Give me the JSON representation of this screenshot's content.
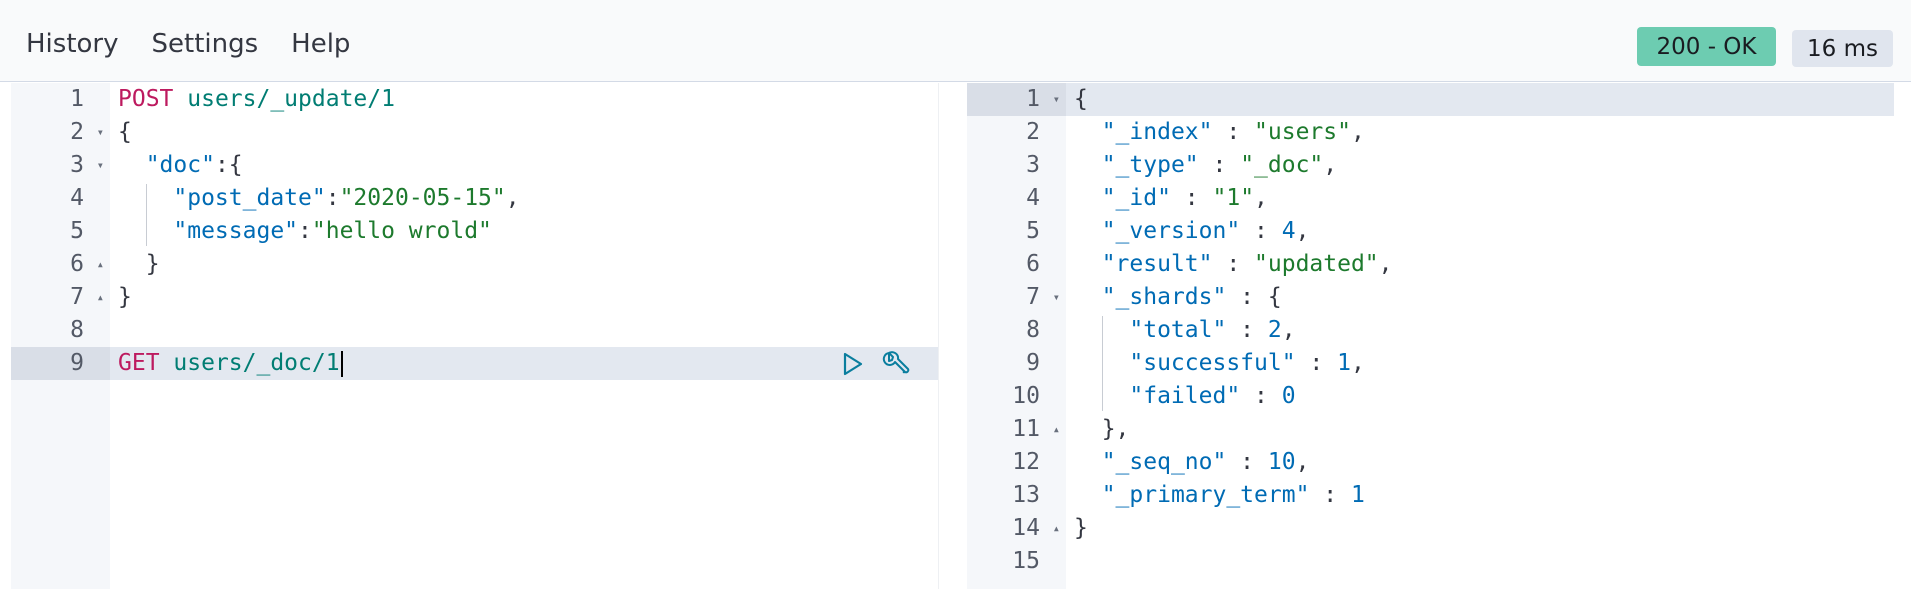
{
  "menu": {
    "items": [
      "History",
      "Settings",
      "Help"
    ]
  },
  "status": {
    "code_text": "200 - OK",
    "time_text": "16 ms",
    "ok_color": "#6dccb1"
  },
  "request": {
    "lines": [
      {
        "n": "1",
        "fold": "",
        "segments": [
          [
            "kw",
            "POST"
          ],
          [
            "plain",
            " "
          ],
          [
            "url",
            "users/_update/1"
          ]
        ]
      },
      {
        "n": "2",
        "fold": "down",
        "segments": [
          [
            "plain",
            "{"
          ]
        ]
      },
      {
        "n": "3",
        "fold": "down",
        "segments": [
          [
            "plain",
            "  "
          ],
          [
            "key",
            "\"doc\""
          ],
          [
            "plain",
            ":{"
          ]
        ]
      },
      {
        "n": "4",
        "fold": "",
        "segments": [
          [
            "plain",
            "    "
          ],
          [
            "key",
            "\"post_date\""
          ],
          [
            "plain",
            ":"
          ],
          [
            "str",
            "\"2020-05-15\""
          ],
          [
            "plain",
            ","
          ]
        ]
      },
      {
        "n": "5",
        "fold": "",
        "segments": [
          [
            "plain",
            "    "
          ],
          [
            "key",
            "\"message\""
          ],
          [
            "plain",
            ":"
          ],
          [
            "str",
            "\"hello wrold\""
          ]
        ]
      },
      {
        "n": "6",
        "fold": "up",
        "segments": [
          [
            "plain",
            "  }"
          ]
        ]
      },
      {
        "n": "7",
        "fold": "up",
        "segments": [
          [
            "plain",
            "}"
          ]
        ]
      },
      {
        "n": "8",
        "fold": "",
        "segments": []
      },
      {
        "n": "9",
        "fold": "",
        "segments": [
          [
            "kw",
            "GET"
          ],
          [
            "plain",
            " "
          ],
          [
            "url",
            "users/_doc/1"
          ]
        ],
        "active": true,
        "cursor": true
      }
    ],
    "actions": [
      "play-icon",
      "wrench-icon"
    ]
  },
  "response": {
    "lines": [
      {
        "n": "1",
        "fold": "down",
        "segments": [
          [
            "plain",
            "{"
          ]
        ],
        "active": true
      },
      {
        "n": "2",
        "fold": "",
        "segments": [
          [
            "plain",
            "  "
          ],
          [
            "key",
            "\"_index\""
          ],
          [
            "plain",
            " : "
          ],
          [
            "str",
            "\"users\""
          ],
          [
            "plain",
            ","
          ]
        ]
      },
      {
        "n": "3",
        "fold": "",
        "segments": [
          [
            "plain",
            "  "
          ],
          [
            "key",
            "\"_type\""
          ],
          [
            "plain",
            " : "
          ],
          [
            "str",
            "\"_doc\""
          ],
          [
            "plain",
            ","
          ]
        ]
      },
      {
        "n": "4",
        "fold": "",
        "segments": [
          [
            "plain",
            "  "
          ],
          [
            "key",
            "\"_id\""
          ],
          [
            "plain",
            " : "
          ],
          [
            "str",
            "\"1\""
          ],
          [
            "plain",
            ","
          ]
        ]
      },
      {
        "n": "5",
        "fold": "",
        "segments": [
          [
            "plain",
            "  "
          ],
          [
            "key",
            "\"_version\""
          ],
          [
            "plain",
            " : "
          ],
          [
            "num",
            "4"
          ],
          [
            "plain",
            ","
          ]
        ]
      },
      {
        "n": "6",
        "fold": "",
        "segments": [
          [
            "plain",
            "  "
          ],
          [
            "key",
            "\"result\""
          ],
          [
            "plain",
            " : "
          ],
          [
            "str",
            "\"updated\""
          ],
          [
            "plain",
            ","
          ]
        ]
      },
      {
        "n": "7",
        "fold": "down",
        "segments": [
          [
            "plain",
            "  "
          ],
          [
            "key",
            "\"_shards\""
          ],
          [
            "plain",
            " : {"
          ]
        ]
      },
      {
        "n": "8",
        "fold": "",
        "segments": [
          [
            "plain",
            "    "
          ],
          [
            "key",
            "\"total\""
          ],
          [
            "plain",
            " : "
          ],
          [
            "num",
            "2"
          ],
          [
            "plain",
            ","
          ]
        ]
      },
      {
        "n": "9",
        "fold": "",
        "segments": [
          [
            "plain",
            "    "
          ],
          [
            "key",
            "\"successful\""
          ],
          [
            "plain",
            " : "
          ],
          [
            "num",
            "1"
          ],
          [
            "plain",
            ","
          ]
        ]
      },
      {
        "n": "10",
        "fold": "",
        "segments": [
          [
            "plain",
            "    "
          ],
          [
            "key",
            "\"failed\""
          ],
          [
            "plain",
            " : "
          ],
          [
            "num",
            "0"
          ]
        ]
      },
      {
        "n": "11",
        "fold": "up",
        "segments": [
          [
            "plain",
            "  },"
          ]
        ]
      },
      {
        "n": "12",
        "fold": "",
        "segments": [
          [
            "plain",
            "  "
          ],
          [
            "key",
            "\"_seq_no\""
          ],
          [
            "plain",
            " : "
          ],
          [
            "num",
            "10"
          ],
          [
            "plain",
            ","
          ]
        ]
      },
      {
        "n": "13",
        "fold": "",
        "segments": [
          [
            "plain",
            "  "
          ],
          [
            "key",
            "\"_primary_term\""
          ],
          [
            "plain",
            " : "
          ],
          [
            "num",
            "1"
          ]
        ]
      },
      {
        "n": "14",
        "fold": "up",
        "segments": [
          [
            "plain",
            "}"
          ]
        ]
      },
      {
        "n": "15",
        "fold": "",
        "segments": []
      }
    ]
  }
}
